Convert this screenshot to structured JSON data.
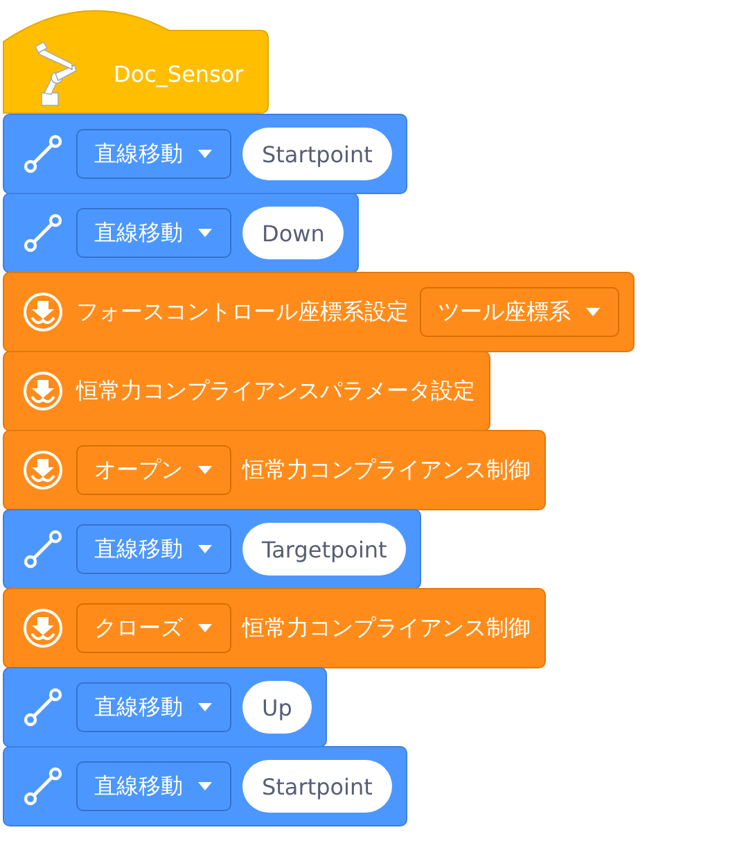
{
  "hat": {
    "title": "Doc_Sensor"
  },
  "blocks": [
    {
      "kind": "move",
      "parts": [
        {
          "kind": "dropdown",
          "text": "直線移動"
        },
        {
          "kind": "value",
          "text": "Startpoint"
        }
      ]
    },
    {
      "kind": "move",
      "parts": [
        {
          "kind": "dropdown",
          "text": "直線移動"
        },
        {
          "kind": "value",
          "text": "Down"
        }
      ]
    },
    {
      "kind": "force",
      "parts": [
        {
          "kind": "label",
          "text": "フォースコントロール座標系設定"
        },
        {
          "kind": "dropdown",
          "text": "ツール座標系"
        }
      ]
    },
    {
      "kind": "force",
      "parts": [
        {
          "kind": "label",
          "text": "恒常力コンプライアンスパラメータ設定"
        }
      ]
    },
    {
      "kind": "force",
      "parts": [
        {
          "kind": "dropdown",
          "text": "オープン"
        },
        {
          "kind": "label",
          "text": "恒常力コンプライアンス制御"
        }
      ]
    },
    {
      "kind": "move",
      "parts": [
        {
          "kind": "dropdown",
          "text": "直線移動"
        },
        {
          "kind": "value",
          "text": "Targetpoint"
        }
      ]
    },
    {
      "kind": "force",
      "parts": [
        {
          "kind": "dropdown",
          "text": "クローズ"
        },
        {
          "kind": "label",
          "text": "恒常力コンプライアンス制御"
        }
      ]
    },
    {
      "kind": "move",
      "parts": [
        {
          "kind": "dropdown",
          "text": "直線移動"
        },
        {
          "kind": "value",
          "text": "Up"
        }
      ]
    },
    {
      "kind": "move",
      "parts": [
        {
          "kind": "dropdown",
          "text": "直線移動"
        },
        {
          "kind": "value",
          "text": "Startpoint"
        }
      ]
    }
  ]
}
